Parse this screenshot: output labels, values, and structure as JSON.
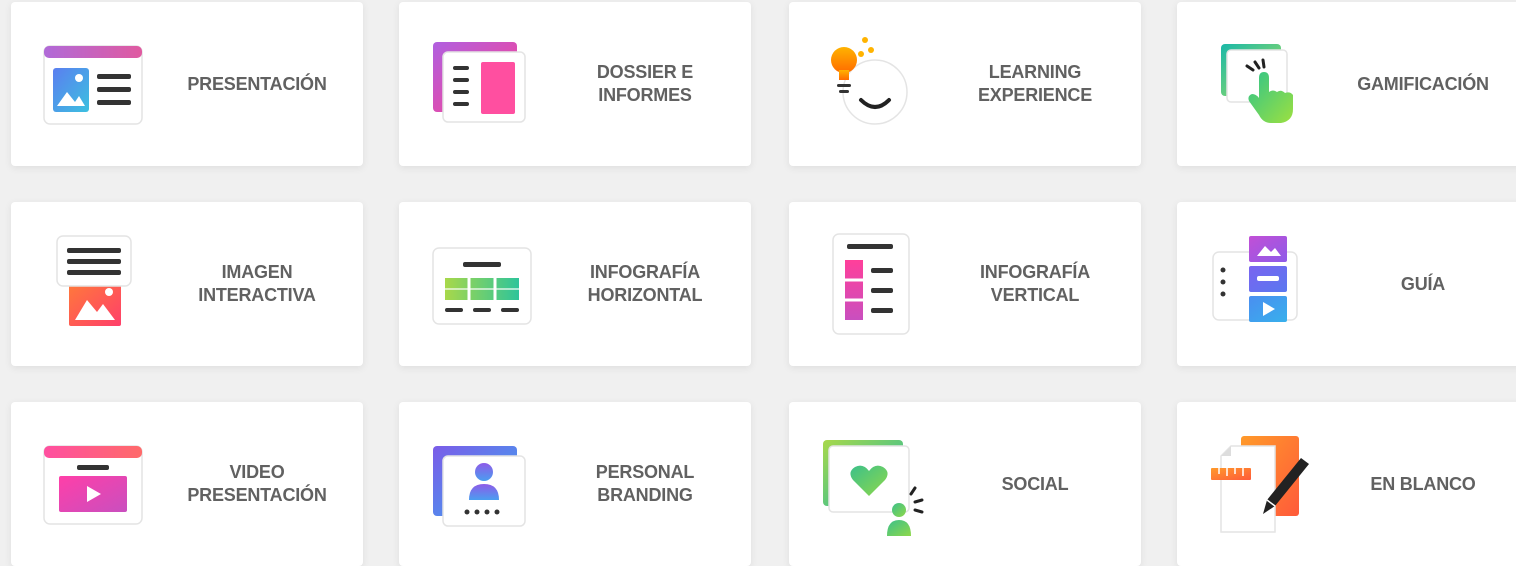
{
  "templates": [
    {
      "label": "PRESENTACIÓN",
      "icon": "presentation-icon"
    },
    {
      "label": "DOSSIER E\nINFORMES",
      "icon": "dossier-icon"
    },
    {
      "label": "LEARNING\nEXPERIENCE",
      "icon": "learning-experience-icon"
    },
    {
      "label": "GAMIFICACIÓN",
      "icon": "gamification-icon"
    },
    {
      "label": "IMAGEN\nINTERACTIVA",
      "icon": "interactive-image-icon"
    },
    {
      "label": "INFOGRAFÍA\nHORIZONTAL",
      "icon": "horizontal-infographic-icon"
    },
    {
      "label": "INFOGRAFÍA\nVERTICAL",
      "icon": "vertical-infographic-icon"
    },
    {
      "label": "GUÍA",
      "icon": "guide-icon"
    },
    {
      "label": "VIDEO\nPRESENTACIÓN",
      "icon": "video-presentation-icon"
    },
    {
      "label": "PERSONAL\nBRANDING",
      "icon": "personal-branding-icon"
    },
    {
      "label": "SOCIAL",
      "icon": "social-icon"
    },
    {
      "label": "EN BLANCO",
      "icon": "blank-icon"
    }
  ],
  "colors": {
    "label_text": "#616161",
    "card_bg": "#ffffff",
    "page_bg": "#f0f0f0"
  }
}
